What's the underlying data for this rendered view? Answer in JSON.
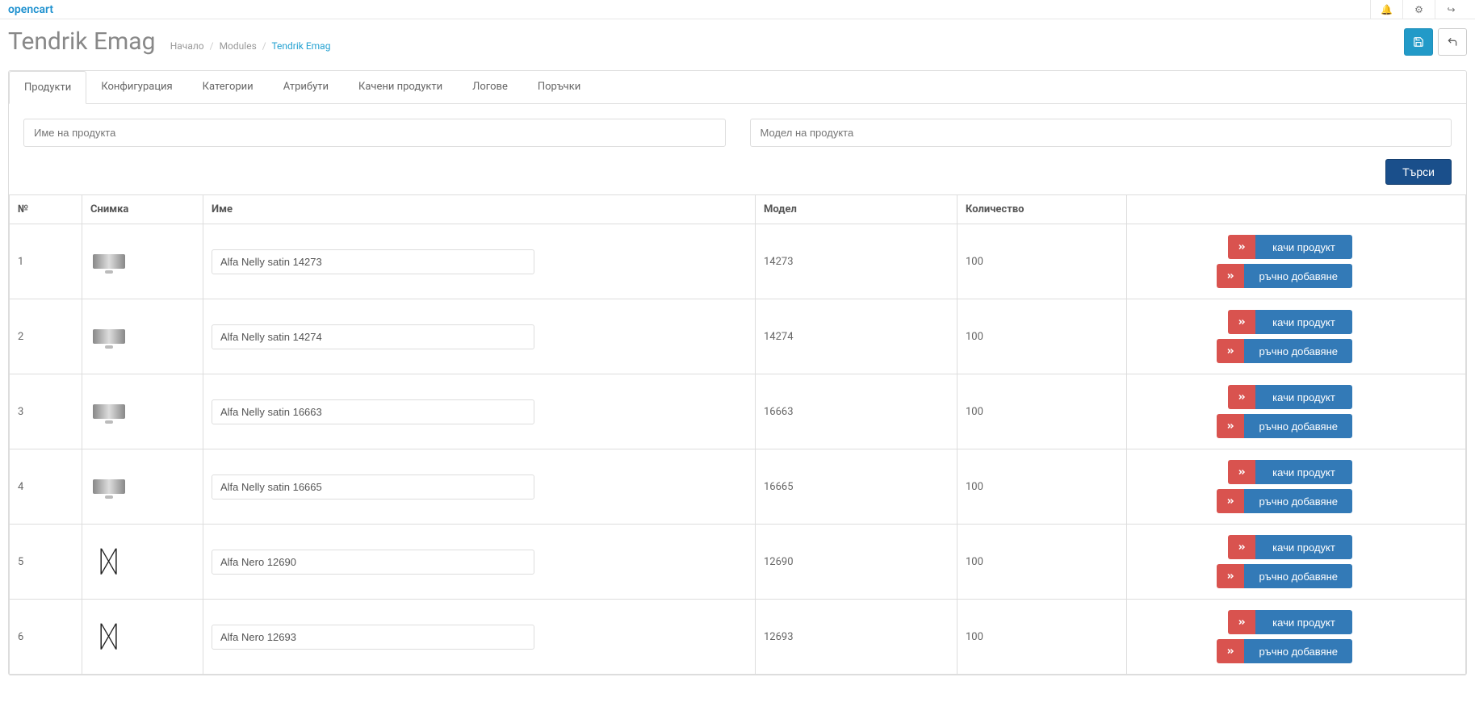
{
  "brand": "opencart",
  "page_title": "Tendrik Emag",
  "breadcrumb": {
    "home": "Начало",
    "modules": "Modules",
    "current": "Tendrik Emag"
  },
  "tabs": [
    "Продукти",
    "Конфигурация",
    "Категории",
    "Атрибути",
    "Качени продукти",
    "Логове",
    "Поръчки"
  ],
  "active_tab": 0,
  "filters": {
    "name_placeholder": "Име на продукта",
    "model_placeholder": "Модел на продукта",
    "search_label": "Търси"
  },
  "columns": {
    "num": "№",
    "image": "Снимка",
    "name": "Име",
    "model": "Модел",
    "qty": "Количество"
  },
  "action_labels": {
    "upload": "качи продукт",
    "manual": "ръчно добавяне"
  },
  "rows": [
    {
      "num": "1",
      "name": "Alfa Nelly satin 14273",
      "model": "14273",
      "qty": "100",
      "thumb": "cylinder"
    },
    {
      "num": "2",
      "name": "Alfa Nelly satin 14274",
      "model": "14274",
      "qty": "100",
      "thumb": "cylinder"
    },
    {
      "num": "3",
      "name": "Alfa Nelly satin 16663",
      "model": "16663",
      "qty": "100",
      "thumb": "cylinder"
    },
    {
      "num": "4",
      "name": "Alfa Nelly satin 16665",
      "model": "16665",
      "qty": "100",
      "thumb": "cylinder"
    },
    {
      "num": "5",
      "name": "Alfa Nero 12690",
      "model": "12690",
      "qty": "100",
      "thumb": "chandelier"
    },
    {
      "num": "6",
      "name": "Alfa Nero 12693",
      "model": "12693",
      "qty": "100",
      "thumb": "chandelier"
    }
  ]
}
